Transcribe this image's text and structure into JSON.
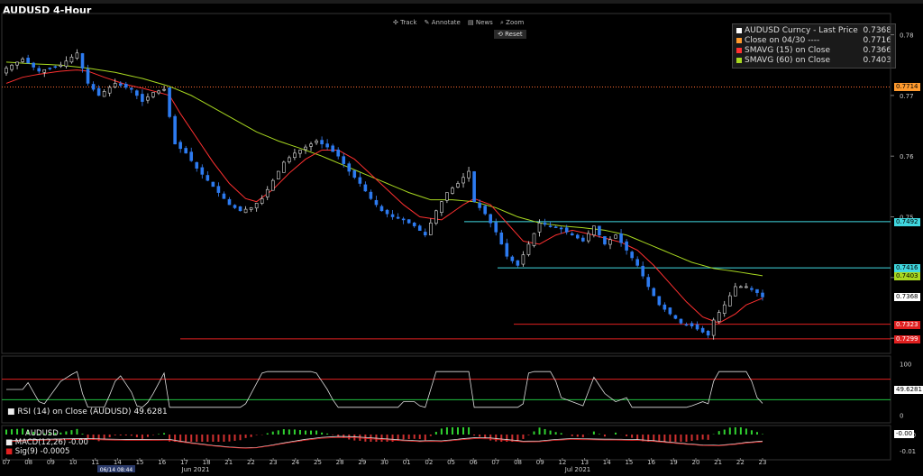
{
  "title": "AUDUSD 4-Hour",
  "toolbar": {
    "track": "Track",
    "annotate": "Annotate",
    "news": "News",
    "zoom": "Zoom",
    "reset": "Reset"
  },
  "legend": [
    {
      "label": "AUDUSD Curncy - Last Price",
      "value": "0.7368",
      "color": "#ffffff"
    },
    {
      "label": "Close on 04/30 ----",
      "value": "0.7716",
      "color": "#ff9a2e"
    },
    {
      "label": "SMAVG (15)  on Close",
      "value": "0.7366",
      "color": "#ff3030"
    },
    {
      "label": "SMAVG (60)  on Close",
      "value": "0.7403",
      "color": "#a8d820"
    }
  ],
  "rsi_legend": {
    "label": "RSI (14)  on Close (AUDUSD)",
    "value": "49.6281"
  },
  "macd_legend": {
    "symbol": "AUDUSD",
    "macd": "MACD(12,26) -0.00",
    "sig": "Sig(9)",
    "sig_value": "-0.0005"
  },
  "price_labels": [
    {
      "text": "0.7714",
      "bg": "#ff9a2e",
      "fg": "#000"
    },
    {
      "text": "0.7492",
      "bg": "#40d8e0",
      "fg": "#000"
    },
    {
      "text": "0.7416",
      "bg": "#40d8e0",
      "fg": "#000"
    },
    {
      "text": "0.7403",
      "bg": "#a8d820",
      "fg": "#000"
    },
    {
      "text": "0.7368",
      "bg": "#ffffff",
      "fg": "#000"
    },
    {
      "text": "0.7323",
      "bg": "#e02020",
      "fg": "#fff"
    },
    {
      "text": "0.7299",
      "bg": "#e02020",
      "fg": "#fff"
    }
  ],
  "rsi_value_label": "49.6281",
  "macd_value_label": "-0.00",
  "date_marker": "06/14 08:44",
  "chart_data": {
    "type": "candlestick",
    "title": "AUDUSD 4-Hour",
    "y_axis_ticks": [
      0.78,
      0.77,
      0.76,
      0.75,
      0.74,
      0.73
    ],
    "ylim": [
      0.7275,
      0.7835
    ],
    "x_day_labels": [
      "07",
      "08",
      "09",
      "10",
      "11",
      "14",
      "15",
      "16",
      "17",
      "18",
      "21",
      "22",
      "23",
      "24",
      "25",
      "28",
      "29",
      "30",
      "01",
      "02",
      "05",
      "06",
      "07",
      "08",
      "09",
      "12",
      "13",
      "14",
      "15",
      "16",
      "19",
      "20",
      "21",
      "22",
      "23"
    ],
    "x_month_labels": [
      "Jun 2021",
      "Jul 2021"
    ],
    "horizontal_levels": [
      {
        "value": 0.7714,
        "color": "#ff6a30",
        "style": "dotted"
      },
      {
        "value": 0.7492,
        "color": "#40d8e0"
      },
      {
        "value": 0.7416,
        "color": "#40d8e0"
      },
      {
        "value": 0.7323,
        "color": "#e02020"
      },
      {
        "value": 0.7299,
        "color": "#e02020"
      }
    ],
    "close_path": [
      [
        0,
        0.7745
      ],
      [
        3,
        0.776
      ],
      [
        6,
        0.774
      ],
      [
        10,
        0.775
      ],
      [
        13,
        0.777
      ],
      [
        15,
        0.772
      ],
      [
        17,
        0.77
      ],
      [
        20,
        0.772
      ],
      [
        23,
        0.771
      ],
      [
        25,
        0.769
      ],
      [
        27,
        0.7705
      ],
      [
        29,
        0.771
      ],
      [
        31,
        0.762
      ],
      [
        33,
        0.7605
      ],
      [
        35,
        0.758
      ],
      [
        37,
        0.756
      ],
      [
        39,
        0.754
      ],
      [
        41,
        0.752
      ],
      [
        43,
        0.751
      ],
      [
        45,
        0.7515
      ],
      [
        47,
        0.753
      ],
      [
        49,
        0.756
      ],
      [
        51,
        0.759
      ],
      [
        53,
        0.7605
      ],
      [
        55,
        0.7615
      ],
      [
        57,
        0.7625
      ],
      [
        59,
        0.7615
      ],
      [
        61,
        0.76
      ],
      [
        63,
        0.7575
      ],
      [
        65,
        0.7555
      ],
      [
        67,
        0.753
      ],
      [
        69,
        0.751
      ],
      [
        71,
        0.75
      ],
      [
        73,
        0.7495
      ],
      [
        75,
        0.7485
      ],
      [
        77,
        0.747
      ],
      [
        79,
        0.751
      ],
      [
        81,
        0.754
      ],
      [
        83,
        0.7555
      ],
      [
        85,
        0.7575
      ],
      [
        86,
        0.7525
      ],
      [
        88,
        0.7505
      ],
      [
        90,
        0.7475
      ],
      [
        92,
        0.7435
      ],
      [
        94,
        0.742
      ],
      [
        96,
        0.7455
      ],
      [
        98,
        0.749
      ],
      [
        100,
        0.7485
      ],
      [
        102,
        0.748
      ],
      [
        104,
        0.747
      ],
      [
        106,
        0.746
      ],
      [
        108,
        0.7485
      ],
      [
        110,
        0.7455
      ],
      [
        112,
        0.747
      ],
      [
        114,
        0.7445
      ],
      [
        116,
        0.742
      ],
      [
        118,
        0.7385
      ],
      [
        120,
        0.7355
      ],
      [
        122,
        0.734
      ],
      [
        124,
        0.7325
      ],
      [
        126,
        0.732
      ],
      [
        128,
        0.731
      ],
      [
        129,
        0.7305
      ],
      [
        130,
        0.733
      ],
      [
        132,
        0.7355
      ],
      [
        134,
        0.7385
      ],
      [
        136,
        0.7385
      ],
      [
        138,
        0.7375
      ],
      [
        139,
        0.7368
      ]
    ],
    "sma15_path": [
      [
        0,
        0.772
      ],
      [
        3,
        0.773
      ],
      [
        6,
        0.7735
      ],
      [
        10,
        0.774
      ],
      [
        13,
        0.7742
      ],
      [
        15,
        0.774
      ],
      [
        18,
        0.773
      ],
      [
        22,
        0.7718
      ],
      [
        25,
        0.7712
      ],
      [
        28,
        0.7705
      ],
      [
        30,
        0.77
      ],
      [
        32,
        0.767
      ],
      [
        35,
        0.763
      ],
      [
        38,
        0.759
      ],
      [
        41,
        0.7555
      ],
      [
        44,
        0.753
      ],
      [
        46,
        0.7525
      ],
      [
        49,
        0.7545
      ],
      [
        52,
        0.7572
      ],
      [
        55,
        0.7595
      ],
      [
        58,
        0.761
      ],
      [
        61,
        0.761
      ],
      [
        64,
        0.7595
      ],
      [
        67,
        0.757
      ],
      [
        70,
        0.7545
      ],
      [
        73,
        0.752
      ],
      [
        76,
        0.75
      ],
      [
        80,
        0.7495
      ],
      [
        84,
        0.752
      ],
      [
        86,
        0.753
      ],
      [
        89,
        0.752
      ],
      [
        92,
        0.749
      ],
      [
        95,
        0.746
      ],
      [
        98,
        0.7455
      ],
      [
        101,
        0.747
      ],
      [
        104,
        0.7478
      ],
      [
        107,
        0.7472
      ],
      [
        110,
        0.7465
      ],
      [
        113,
        0.7458
      ],
      [
        116,
        0.7445
      ],
      [
        119,
        0.742
      ],
      [
        122,
        0.739
      ],
      [
        125,
        0.736
      ],
      [
        128,
        0.7335
      ],
      [
        131,
        0.7325
      ],
      [
        134,
        0.734
      ],
      [
        136,
        0.7355
      ],
      [
        139,
        0.7366
      ]
    ],
    "sma60_path": [
      [
        0,
        0.7755
      ],
      [
        5,
        0.7752
      ],
      [
        10,
        0.775
      ],
      [
        15,
        0.7745
      ],
      [
        20,
        0.7738
      ],
      [
        25,
        0.7728
      ],
      [
        30,
        0.7715
      ],
      [
        34,
        0.77
      ],
      [
        38,
        0.768
      ],
      [
        42,
        0.766
      ],
      [
        46,
        0.764
      ],
      [
        50,
        0.7625
      ],
      [
        54,
        0.7613
      ],
      [
        58,
        0.76
      ],
      [
        62,
        0.7585
      ],
      [
        66,
        0.757
      ],
      [
        70,
        0.7555
      ],
      [
        74,
        0.754
      ],
      [
        78,
        0.7528
      ],
      [
        82,
        0.7528
      ],
      [
        86,
        0.7525
      ],
      [
        90,
        0.7515
      ],
      [
        94,
        0.75
      ],
      [
        98,
        0.749
      ],
      [
        102,
        0.7485
      ],
      [
        106,
        0.7482
      ],
      [
        110,
        0.7478
      ],
      [
        114,
        0.747
      ],
      [
        118,
        0.7455
      ],
      [
        122,
        0.744
      ],
      [
        126,
        0.7425
      ],
      [
        130,
        0.7415
      ],
      [
        134,
        0.741
      ],
      [
        139,
        0.7403
      ]
    ],
    "rsi": {
      "ylim": [
        -10,
        110
      ],
      "ticks": [
        100,
        50,
        0
      ],
      "upper": 70,
      "lower": 30,
      "last": 49.6281
    },
    "macd": {
      "ticks": [
        "-0.00",
        "-0.01"
      ],
      "last_macd": -0.0,
      "last_signal": -0.0005
    }
  }
}
